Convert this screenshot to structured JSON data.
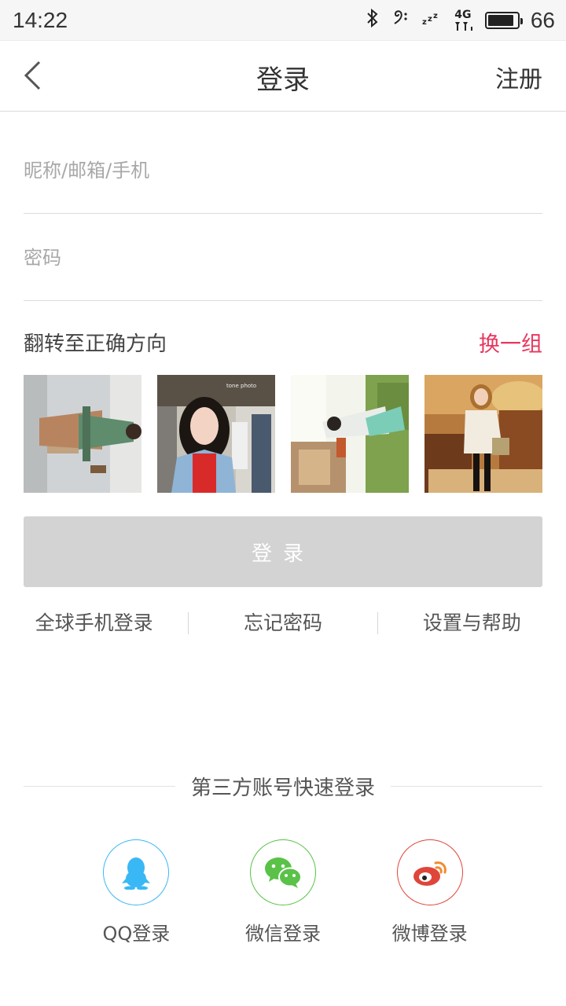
{
  "status_bar": {
    "time": "14:22",
    "battery_text": "66",
    "battery_level": 0.66,
    "network": "4G",
    "icons": [
      "bluetooth-icon",
      "music-note-icon",
      "sleep-icon",
      "signal-icon",
      "battery-icon"
    ]
  },
  "nav": {
    "title": "登录",
    "register_label": "注册",
    "back_icon": "chevron-left-icon"
  },
  "form": {
    "username_placeholder": "昵称/邮箱/手机",
    "username_value": "",
    "password_placeholder": "密码",
    "password_value": ""
  },
  "captcha": {
    "label": "翻转至正确方向",
    "refresh_label": "换一组"
  },
  "login_button": {
    "label": "登录"
  },
  "links": {
    "global_phone": "全球手机登录",
    "forgot_password": "忘记密码",
    "settings_help": "设置与帮助"
  },
  "third_party": {
    "title": "第三方账号快速登录",
    "items": [
      {
        "label": "QQ登录",
        "icon": "qq-penguin-icon",
        "color": "#3ab8f5"
      },
      {
        "label": "微信登录",
        "icon": "wechat-icon",
        "color": "#59c247"
      },
      {
        "label": "微博登录",
        "icon": "weibo-icon",
        "color": "#e0453a"
      }
    ]
  },
  "colors": {
    "accent": "#e8375e",
    "login_button_bg": "#d3d3d3"
  }
}
